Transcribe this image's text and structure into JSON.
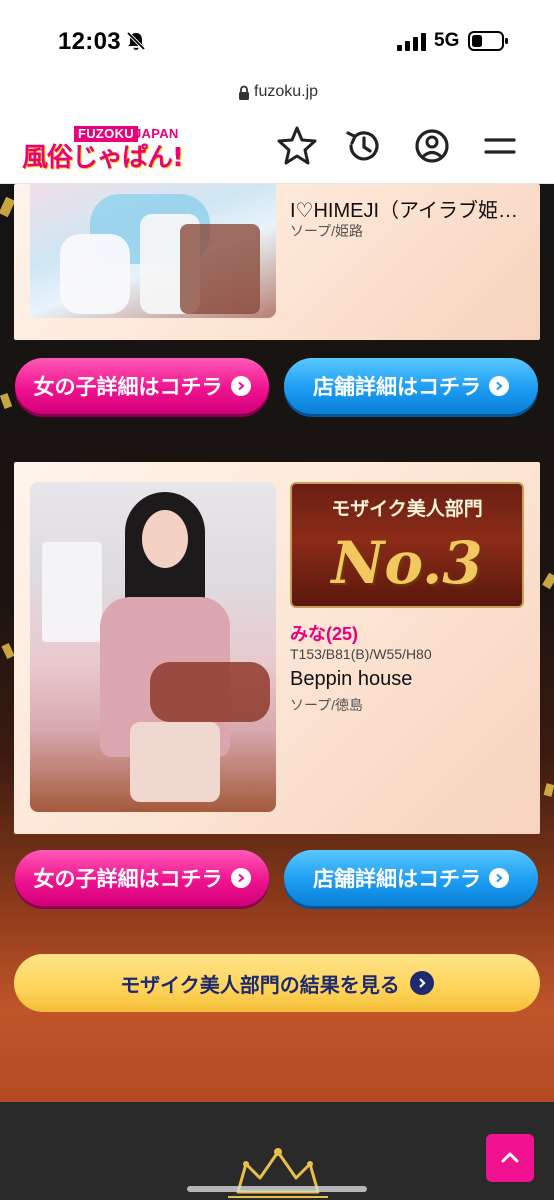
{
  "status_bar": {
    "time": "12:03",
    "network": "5G"
  },
  "url_bar": {
    "url": "fuzoku.jp"
  },
  "header": {
    "logo_top_left": "FUZOKU",
    "logo_top_right": "JAPAN",
    "logo_main": "風俗じゃぱん!",
    "icons": [
      "star-icon",
      "history-icon",
      "account-icon",
      "menu-icon"
    ]
  },
  "cards": [
    {
      "shop_name": "I♡HIMEJI（アイラブ姫…",
      "shop_type": "ソープ/姫路"
    },
    {
      "rank_category": "モザイク美人部門",
      "rank_number": "No.3",
      "girl_name": "みな(25)",
      "girl_stats": "T153/B81(B)/W55/H80",
      "shop_name": "Beppin house",
      "shop_type": "ソープ/徳島"
    }
  ],
  "buttons": {
    "girl_detail": "女の子詳細はコチラ",
    "shop_detail": "店舗詳細はコチラ",
    "results": "モザイク美人部門の結果を見る"
  },
  "colors": {
    "brand_pink": "#e8007d",
    "button_blue": "#1c9cf2",
    "results_yellow": "#ffd45a",
    "results_text": "#1e2a6e"
  }
}
